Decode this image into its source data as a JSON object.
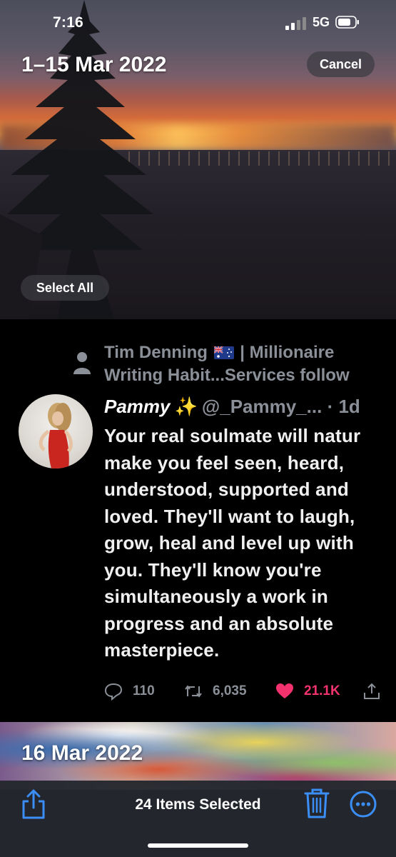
{
  "status_bar": {
    "time": "7:16",
    "network": "5G",
    "signal_icon": "cellular-signal-icon",
    "battery_icon": "battery-icon"
  },
  "header": {
    "date_range": "1–15 Mar 2022",
    "cancel_label": "Cancel",
    "select_all_label": "Select All"
  },
  "tweet": {
    "retweeted_by_line1_pre": "Tim Denning",
    "retweeted_by_line1_post": "| Millionaire",
    "retweeted_by_line2": "Writing Habit...Services follow",
    "author_name": "Pammy",
    "author_handle": "@_Pammy_...",
    "age": "· 1d",
    "text": "Your real soulmate will natur\nmake you feel seen, heard,\nunderstood, supported and\nloved. They'll want to laugh,\ngrow, heal and level up with\nyou. They'll know you're\nsimultaneously a work in\nprogress and an absolute\nmasterpiece.",
    "replies": "110",
    "retweets": "6,035",
    "likes": "21.1K",
    "like_color": "#f4336e"
  },
  "second_section": {
    "date_label": "16 Mar 2022"
  },
  "toolbar": {
    "selected_label": "24 Items Selected",
    "accent_color": "#3a8ef6"
  }
}
